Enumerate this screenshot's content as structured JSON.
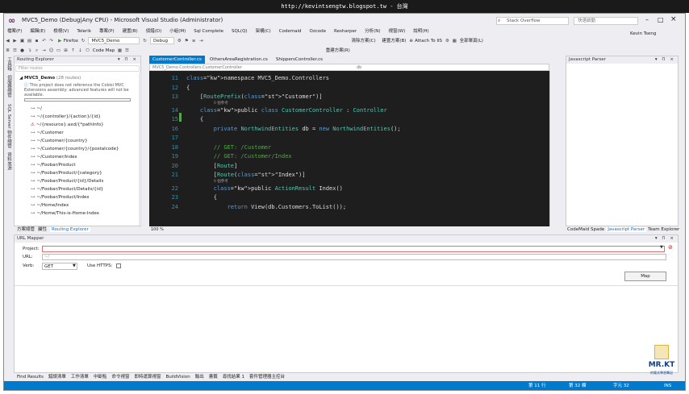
{
  "browser_bar": {
    "url_text": "http://kevintsengtw.blogspot.tw - 台灣"
  },
  "window": {
    "title": "MVC5_Demo (Debug|Any CPU) - Microsoft Visual Studio (Administrator)",
    "quick_launch_placeholder": "Stack Overflow",
    "search_placeholder": "快速啟動",
    "user": "Kevin Tseng"
  },
  "menu": [
    "檔案(F)",
    "編輯(E)",
    "檢視(V)",
    "Telerik",
    "專案(P)",
    "建置(B)",
    "偵錯(D)",
    "小組(M)",
    "Sql Complete",
    "SQL(Q)",
    "架構(C)",
    "Codemaid",
    "Ozcode",
    "Resharper",
    "分析(N)",
    "視窗(W)",
    "說明(H)"
  ],
  "toolbar": {
    "browser": "Firefox",
    "project_combo": "MVC5_Demo",
    "config_combo": "Debug",
    "attach_label": "Attach To IIS",
    "solution_label": "全部單頁(L)",
    "code_map": "Code Map",
    "clean_label": "清除方案(C)",
    "build_label": "建置方案(B)",
    "rebuild_label": "重建方案(R)"
  },
  "left_strip": [
    "工具箱",
    "伺服器總管",
    "SQL Server 物件總管",
    "資料來源"
  ],
  "routing_explorer": {
    "title": "Routing Explorer",
    "filter_placeholder": "Filter routes",
    "root_name": "MVC5_Demo",
    "root_count": "(28 routes)",
    "warning": "This project does not reference the Cobisi MVC Extensions assembly: advanced features will not be available.",
    "routes": [
      {
        "text": "~/",
        "error": false
      },
      {
        "text": "~/{controller}/{action}/{id}",
        "error": false
      },
      {
        "text": "~/{resource}.axd/{*pathInfo}",
        "error": true
      },
      {
        "text": "~/Customer",
        "error": false
      },
      {
        "text": "~/Customer/{country}",
        "error": false
      },
      {
        "text": "~/Customer/{country}/{postalcode}",
        "error": false
      },
      {
        "text": "~/Customer/Index",
        "error": false
      },
      {
        "text": "~/Foobar/Product",
        "error": false
      },
      {
        "text": "~/Foobar/Product/{category}",
        "error": false
      },
      {
        "text": "~/Foobar/Product/{id}/Details",
        "error": false
      },
      {
        "text": "~/Foobar/Product/Details/{id}",
        "error": false
      },
      {
        "text": "~/Foobar/Product/Index",
        "error": false
      },
      {
        "text": "~/Home/Index",
        "error": false
      },
      {
        "text": "~/Home/This-is-Home-Index",
        "error": false
      }
    ],
    "tabs": [
      "方案總管",
      "屬性",
      "Routing Explorer"
    ]
  },
  "editor": {
    "tabs": [
      "CustomerController.cs",
      "OthersAreaRegistration.cs",
      "ShippersController.cs"
    ],
    "nav_left": "MVC5_Demo.Controllers.CustomerController",
    "nav_right": "db",
    "zoom": "100 %",
    "lines": [
      {
        "num": "11",
        "code": "namespace MVC5_Demo.Controllers"
      },
      {
        "num": "12",
        "code": "{"
      },
      {
        "num": "13",
        "code": "    [RoutePrefix(\"Customer\")]"
      },
      {
        "num": "14",
        "code": "    public class CustomerController : Controller"
      },
      {
        "num": "15",
        "code": "    {"
      },
      {
        "num": "16",
        "code": "        private NorthwindEntities db = new NorthwindEntities();"
      },
      {
        "num": "17",
        "code": ""
      },
      {
        "num": "18",
        "code": "        // GET: /Customer"
      },
      {
        "num": "19",
        "code": "        // GET: /Customer/Index"
      },
      {
        "num": "20",
        "code": "        [Route]"
      },
      {
        "num": "21",
        "code": "        [Route(\"Index\")]"
      },
      {
        "num": "22",
        "code": "        public ActionResult Index()"
      },
      {
        "num": "23",
        "code": "        {"
      },
      {
        "num": "24",
        "code": "            return View(db.Customers.ToList());"
      }
    ],
    "codelens": "0 個參考"
  },
  "js_parser": {
    "title": "Javascript Parser",
    "tabs": [
      "CodeMaid Spade",
      "Javascript Parser",
      "Team Explorer"
    ]
  },
  "url_mapper": {
    "title": "URL Mapper",
    "project_label": "Project:",
    "url_label": "URL:",
    "url_value": "~/",
    "verb_label": "Verb:",
    "verb_value": "GET",
    "https_label": "Use HTTPS:",
    "map_button": "Map"
  },
  "bottom_tabs": [
    "Find Results",
    "錯誤清單",
    "工作清單",
    "中斷點",
    "命令視窗",
    "即時運算視窗",
    "BuildVision",
    "輸出",
    "書籤",
    "尋找結果 1",
    "套件管理器主控台"
  ],
  "status": {
    "line": "第 11 行",
    "col": "第 32 欄",
    "ch": "字元 32",
    "mode": "INS"
  },
  "logo": {
    "text": "MR.KT",
    "sub": "的電式學習筆記"
  }
}
